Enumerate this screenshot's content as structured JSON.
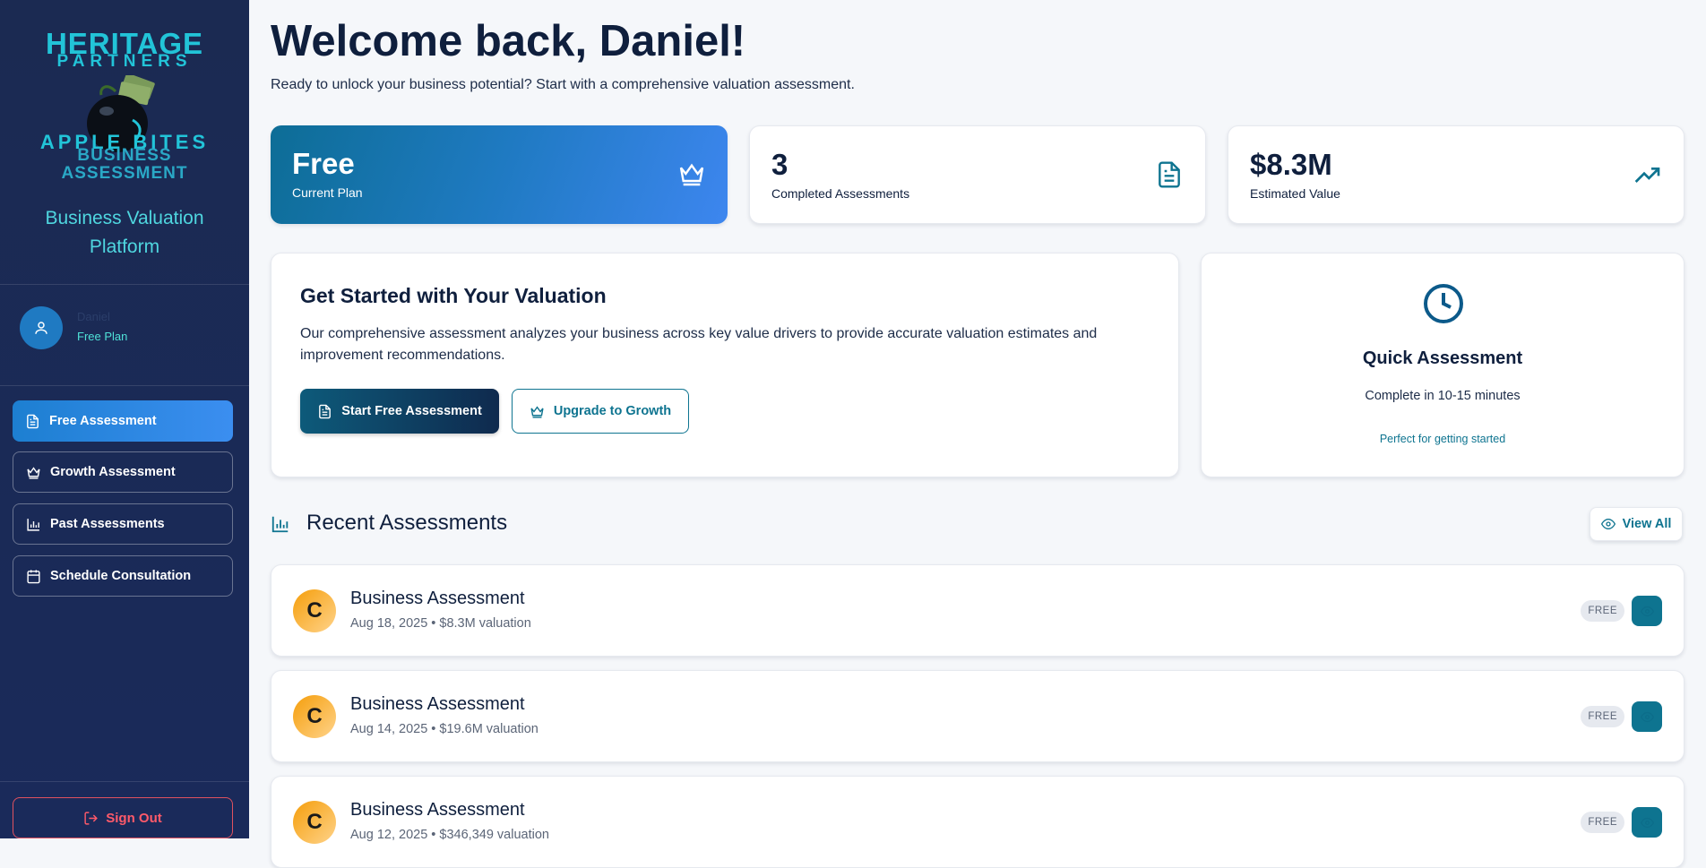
{
  "brand": {
    "logo_line1": "HERITAGE",
    "logo_line2": "PARTNERS",
    "logo_line3": "APPLE BITES",
    "logo_line4": "BUSINESS",
    "logo_line5": "ASSESSMENT",
    "platform_title": "Business Valuation Platform"
  },
  "user": {
    "name": "Daniel",
    "plan": "Free Plan"
  },
  "nav": [
    {
      "label": "Free Assessment",
      "icon": "document-icon",
      "active": true
    },
    {
      "label": "Growth Assessment",
      "icon": "crown-icon",
      "active": false
    },
    {
      "label": "Past Assessments",
      "icon": "bar-chart-icon",
      "active": false
    },
    {
      "label": "Schedule Consultation",
      "icon": "calendar-icon",
      "active": false
    }
  ],
  "signout_label": "Sign Out",
  "header": {
    "welcome": "Welcome back, Daniel!",
    "subtitle": "Ready to unlock your business potential? Start with a comprehensive valuation assessment."
  },
  "stats": [
    {
      "value": "Free",
      "label": "Current Plan",
      "icon": "crown-icon"
    },
    {
      "value": "3",
      "label": "Completed Assessments",
      "icon": "document-icon"
    },
    {
      "value": "$8.3M",
      "label": "Estimated Value",
      "icon": "trending-up-icon"
    }
  ],
  "get_started": {
    "title": "Get Started with Your Valuation",
    "text": "Our comprehensive assessment analyzes your business across key value drivers to provide accurate valuation estimates and improvement recommendations.",
    "primary_button": "Start Free Assessment",
    "secondary_button": "Upgrade to Growth"
  },
  "quick": {
    "title": "Quick Assessment",
    "subtitle": "Complete in 10-15 minutes",
    "note": "Perfect for getting started"
  },
  "recent": {
    "title": "Recent Assessments",
    "view_all": "View All",
    "items": [
      {
        "initial": "C",
        "title": "Business Assessment",
        "meta": "Aug 18, 2025 • $8.3M valuation",
        "tier": "FREE"
      },
      {
        "initial": "C",
        "title": "Business Assessment",
        "meta": "Aug 14, 2025 • $19.6M valuation",
        "tier": "FREE"
      },
      {
        "initial": "C",
        "title": "Business Assessment",
        "meta": "Aug 12, 2025 • $346,349 valuation",
        "tier": "FREE"
      }
    ]
  },
  "colors": {
    "sidebar_bg": "#1b2a52",
    "accent_teal": "#0e7490",
    "accent_blue": "#3b8ef0",
    "signout_red": "#ff5a6a"
  }
}
